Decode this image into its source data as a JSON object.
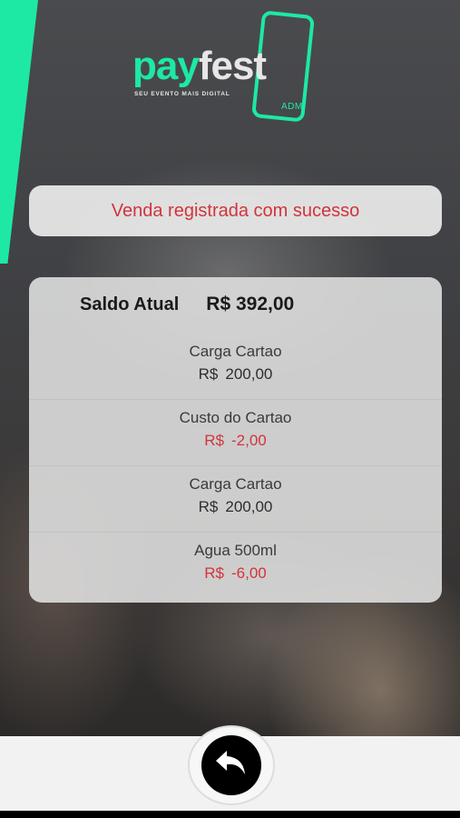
{
  "logo": {
    "pay": "pay",
    "fest": "fest",
    "tagline": "SEU EVENTO MAIS DIGITAL",
    "badge": "ADM"
  },
  "message": "Venda registrada com sucesso",
  "balance": {
    "label": "Saldo Atual",
    "value": "R$ 392,00"
  },
  "entries": [
    {
      "description": "Carga Cartao",
      "currency": "R$",
      "amount": "200,00",
      "type": "positive"
    },
    {
      "description": "Custo do Cartao",
      "currency": "R$",
      "amount": "-2,00",
      "type": "negative"
    },
    {
      "description": "Carga Cartao",
      "currency": "R$",
      "amount": "200,00",
      "type": "positive"
    },
    {
      "description": "Agua 500ml",
      "currency": "R$",
      "amount": "-6,00",
      "type": "negative"
    }
  ],
  "colors": {
    "accent": "#1de9a4",
    "negative": "#d2343c",
    "text_dark": "#1a1a1a"
  },
  "icons": {
    "back": "back-arrow-icon"
  }
}
